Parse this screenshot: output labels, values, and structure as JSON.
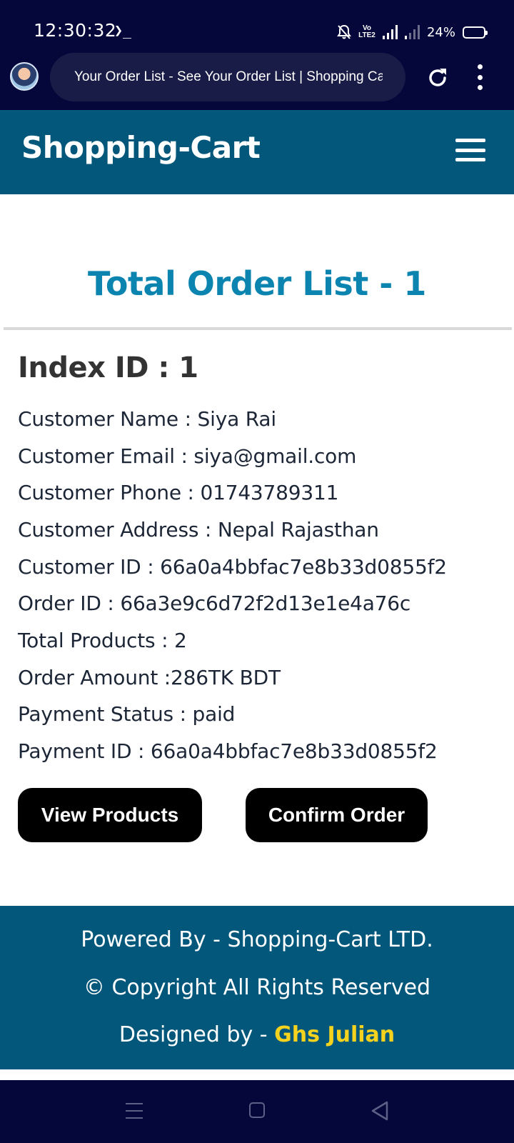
{
  "status_bar": {
    "time": "12:30:32",
    "terminal_glyph": "❯_",
    "volte": "Vo LTE2",
    "battery": "24%",
    "battery_level": 0.24
  },
  "browser": {
    "tab_title": "Your Order List - See Your Order List | Shopping Ca"
  },
  "navbar": {
    "brand": "Shopping-Cart"
  },
  "main": {
    "title": "Total Order List - 1",
    "order": {
      "index_heading": "Index ID : 1",
      "lines": [
        "Customer Name : Siya Rai",
        "Customer Email : siya@gmail.com",
        "Customer Phone : 01743789311",
        "Customer Address : Nepal Rajasthan",
        "Customer ID : 66a0a4bbfac7e8b33d0855f2",
        "Order ID : 66a3e9c6d72f2d13e1e4a76c",
        "Total Products : 2",
        "Order Amount :286TK BDT",
        "Payment Status : paid",
        "Payment ID : 66a0a4bbfac7e8b33d0855f2"
      ],
      "view_products_label": "View Products",
      "confirm_order_label": "Confirm Order"
    }
  },
  "footer": {
    "powered_by": "Powered By - Shopping-Cart LTD.",
    "copyright": "© Copyright All Rights Reserved",
    "designed_by_prefix": "Designed by - ",
    "designer_name": "Ghs Julian"
  },
  "colors": {
    "status_bg": "#05073a",
    "nav_bg": "#03577a",
    "title_color": "#0c84b0",
    "designer_color": "#f5d21e"
  }
}
